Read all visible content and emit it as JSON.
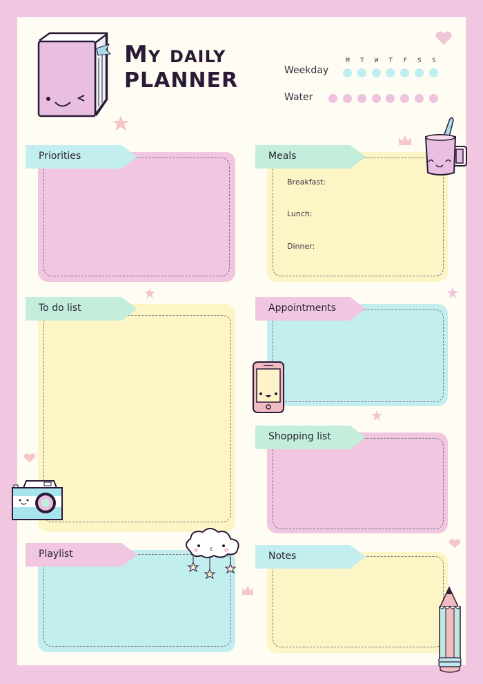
{
  "title": {
    "line1": "My daily",
    "line2": "planner"
  },
  "trackers": {
    "weekday": {
      "label": "Weekday",
      "days": [
        "M",
        "T",
        "W",
        "T",
        "F",
        "S",
        "S"
      ],
      "dot_color": "#bfeef0"
    },
    "water": {
      "label": "Water",
      "count": 8,
      "dot_color": "#efc3df"
    }
  },
  "sections": {
    "priorities": {
      "label": "Priorities"
    },
    "meals": {
      "label": "Meals",
      "items": [
        "Breakfast:",
        "Lunch:",
        "Dinner:"
      ]
    },
    "todo": {
      "label": "To do list"
    },
    "appointments": {
      "label": "Appointments"
    },
    "shopping": {
      "label": "Shopping list"
    },
    "playlist": {
      "label": "Playlist"
    },
    "notes": {
      "label": "Notes"
    }
  },
  "colors": {
    "border": "#f0c6e0",
    "paper": "#fffdf3",
    "pink": "#f0c6e0",
    "yellow": "#fdf5c5",
    "cyan": "#c2eef0",
    "mint": "#c3eedc"
  }
}
